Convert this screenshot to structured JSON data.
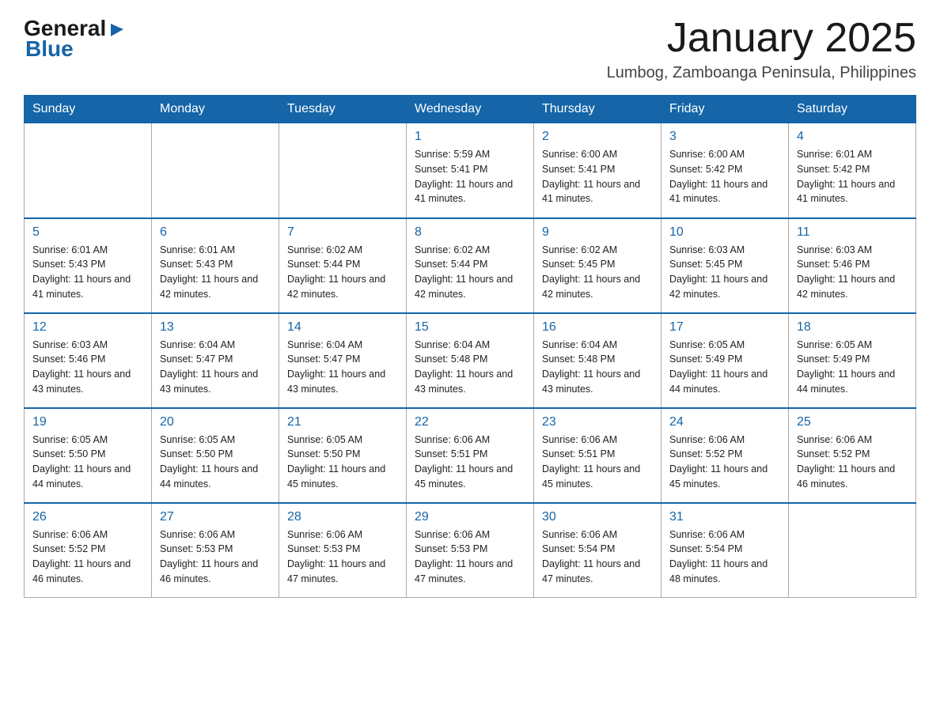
{
  "logo": {
    "general": "General",
    "blue": "Blue",
    "triangle": "▶"
  },
  "title": "January 2025",
  "subtitle": "Lumbog, Zamboanga Peninsula, Philippines",
  "headers": [
    "Sunday",
    "Monday",
    "Tuesday",
    "Wednesday",
    "Thursday",
    "Friday",
    "Saturday"
  ],
  "weeks": [
    [
      {
        "day": "",
        "sunrise": "",
        "sunset": "",
        "daylight": ""
      },
      {
        "day": "",
        "sunrise": "",
        "sunset": "",
        "daylight": ""
      },
      {
        "day": "",
        "sunrise": "",
        "sunset": "",
        "daylight": ""
      },
      {
        "day": "1",
        "sunrise": "Sunrise: 5:59 AM",
        "sunset": "Sunset: 5:41 PM",
        "daylight": "Daylight: 11 hours and 41 minutes."
      },
      {
        "day": "2",
        "sunrise": "Sunrise: 6:00 AM",
        "sunset": "Sunset: 5:41 PM",
        "daylight": "Daylight: 11 hours and 41 minutes."
      },
      {
        "day": "3",
        "sunrise": "Sunrise: 6:00 AM",
        "sunset": "Sunset: 5:42 PM",
        "daylight": "Daylight: 11 hours and 41 minutes."
      },
      {
        "day": "4",
        "sunrise": "Sunrise: 6:01 AM",
        "sunset": "Sunset: 5:42 PM",
        "daylight": "Daylight: 11 hours and 41 minutes."
      }
    ],
    [
      {
        "day": "5",
        "sunrise": "Sunrise: 6:01 AM",
        "sunset": "Sunset: 5:43 PM",
        "daylight": "Daylight: 11 hours and 41 minutes."
      },
      {
        "day": "6",
        "sunrise": "Sunrise: 6:01 AM",
        "sunset": "Sunset: 5:43 PM",
        "daylight": "Daylight: 11 hours and 42 minutes."
      },
      {
        "day": "7",
        "sunrise": "Sunrise: 6:02 AM",
        "sunset": "Sunset: 5:44 PM",
        "daylight": "Daylight: 11 hours and 42 minutes."
      },
      {
        "day": "8",
        "sunrise": "Sunrise: 6:02 AM",
        "sunset": "Sunset: 5:44 PM",
        "daylight": "Daylight: 11 hours and 42 minutes."
      },
      {
        "day": "9",
        "sunrise": "Sunrise: 6:02 AM",
        "sunset": "Sunset: 5:45 PM",
        "daylight": "Daylight: 11 hours and 42 minutes."
      },
      {
        "day": "10",
        "sunrise": "Sunrise: 6:03 AM",
        "sunset": "Sunset: 5:45 PM",
        "daylight": "Daylight: 11 hours and 42 minutes."
      },
      {
        "day": "11",
        "sunrise": "Sunrise: 6:03 AM",
        "sunset": "Sunset: 5:46 PM",
        "daylight": "Daylight: 11 hours and 42 minutes."
      }
    ],
    [
      {
        "day": "12",
        "sunrise": "Sunrise: 6:03 AM",
        "sunset": "Sunset: 5:46 PM",
        "daylight": "Daylight: 11 hours and 43 minutes."
      },
      {
        "day": "13",
        "sunrise": "Sunrise: 6:04 AM",
        "sunset": "Sunset: 5:47 PM",
        "daylight": "Daylight: 11 hours and 43 minutes."
      },
      {
        "day": "14",
        "sunrise": "Sunrise: 6:04 AM",
        "sunset": "Sunset: 5:47 PM",
        "daylight": "Daylight: 11 hours and 43 minutes."
      },
      {
        "day": "15",
        "sunrise": "Sunrise: 6:04 AM",
        "sunset": "Sunset: 5:48 PM",
        "daylight": "Daylight: 11 hours and 43 minutes."
      },
      {
        "day": "16",
        "sunrise": "Sunrise: 6:04 AM",
        "sunset": "Sunset: 5:48 PM",
        "daylight": "Daylight: 11 hours and 43 minutes."
      },
      {
        "day": "17",
        "sunrise": "Sunrise: 6:05 AM",
        "sunset": "Sunset: 5:49 PM",
        "daylight": "Daylight: 11 hours and 44 minutes."
      },
      {
        "day": "18",
        "sunrise": "Sunrise: 6:05 AM",
        "sunset": "Sunset: 5:49 PM",
        "daylight": "Daylight: 11 hours and 44 minutes."
      }
    ],
    [
      {
        "day": "19",
        "sunrise": "Sunrise: 6:05 AM",
        "sunset": "Sunset: 5:50 PM",
        "daylight": "Daylight: 11 hours and 44 minutes."
      },
      {
        "day": "20",
        "sunrise": "Sunrise: 6:05 AM",
        "sunset": "Sunset: 5:50 PM",
        "daylight": "Daylight: 11 hours and 44 minutes."
      },
      {
        "day": "21",
        "sunrise": "Sunrise: 6:05 AM",
        "sunset": "Sunset: 5:50 PM",
        "daylight": "Daylight: 11 hours and 45 minutes."
      },
      {
        "day": "22",
        "sunrise": "Sunrise: 6:06 AM",
        "sunset": "Sunset: 5:51 PM",
        "daylight": "Daylight: 11 hours and 45 minutes."
      },
      {
        "day": "23",
        "sunrise": "Sunrise: 6:06 AM",
        "sunset": "Sunset: 5:51 PM",
        "daylight": "Daylight: 11 hours and 45 minutes."
      },
      {
        "day": "24",
        "sunrise": "Sunrise: 6:06 AM",
        "sunset": "Sunset: 5:52 PM",
        "daylight": "Daylight: 11 hours and 45 minutes."
      },
      {
        "day": "25",
        "sunrise": "Sunrise: 6:06 AM",
        "sunset": "Sunset: 5:52 PM",
        "daylight": "Daylight: 11 hours and 46 minutes."
      }
    ],
    [
      {
        "day": "26",
        "sunrise": "Sunrise: 6:06 AM",
        "sunset": "Sunset: 5:52 PM",
        "daylight": "Daylight: 11 hours and 46 minutes."
      },
      {
        "day": "27",
        "sunrise": "Sunrise: 6:06 AM",
        "sunset": "Sunset: 5:53 PM",
        "daylight": "Daylight: 11 hours and 46 minutes."
      },
      {
        "day": "28",
        "sunrise": "Sunrise: 6:06 AM",
        "sunset": "Sunset: 5:53 PM",
        "daylight": "Daylight: 11 hours and 47 minutes."
      },
      {
        "day": "29",
        "sunrise": "Sunrise: 6:06 AM",
        "sunset": "Sunset: 5:53 PM",
        "daylight": "Daylight: 11 hours and 47 minutes."
      },
      {
        "day": "30",
        "sunrise": "Sunrise: 6:06 AM",
        "sunset": "Sunset: 5:54 PM",
        "daylight": "Daylight: 11 hours and 47 minutes."
      },
      {
        "day": "31",
        "sunrise": "Sunrise: 6:06 AM",
        "sunset": "Sunset: 5:54 PM",
        "daylight": "Daylight: 11 hours and 48 minutes."
      },
      {
        "day": "",
        "sunrise": "",
        "sunset": "",
        "daylight": ""
      }
    ]
  ]
}
